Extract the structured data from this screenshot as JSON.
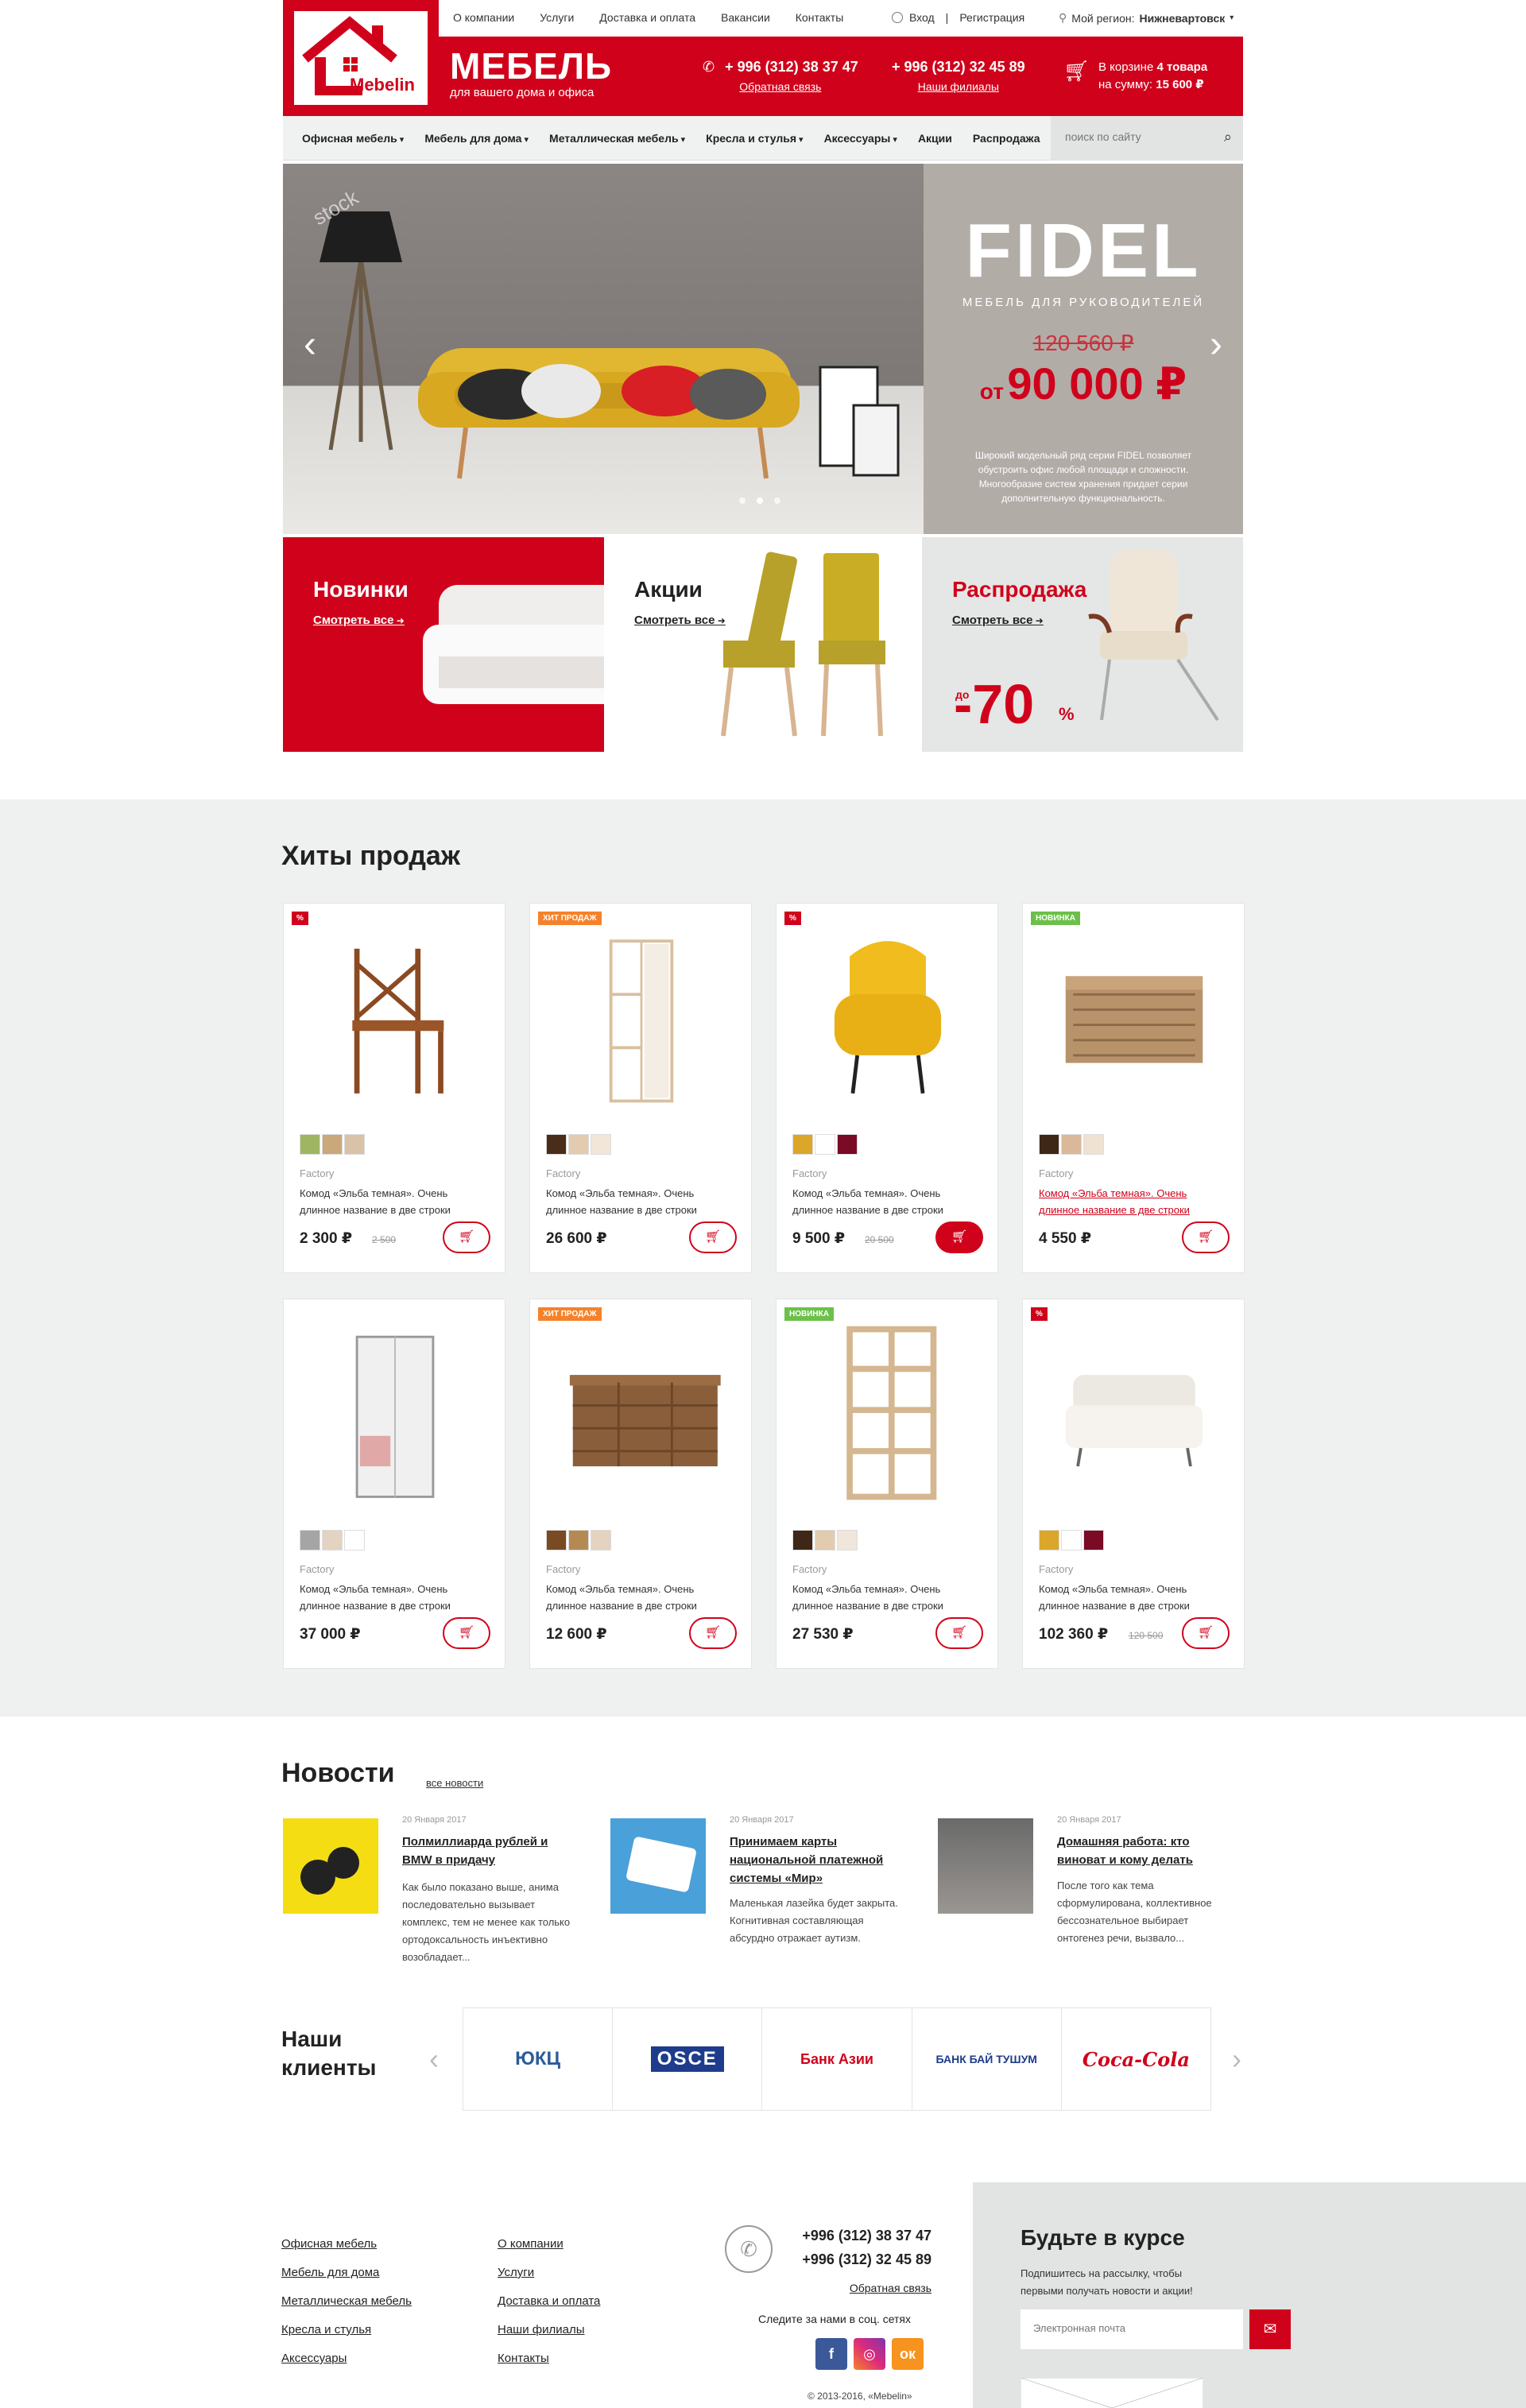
{
  "topnav": {
    "links": [
      "О компании",
      "Услуги",
      "Доставка и оплата",
      "Вакансии",
      "Контакты"
    ],
    "login": "Вход",
    "separator": "|",
    "register": "Регистрация",
    "region_label": "Мой регион:",
    "region_value": "Нижневартовск"
  },
  "logo": {
    "text": "Mebelin"
  },
  "brand": {
    "name": "МЕБЕЛЬ",
    "tagline": "для вашего дома и офиса"
  },
  "header": {
    "phone1": "+ 996 (312) 38 37 47",
    "phone1_sub": "Обратная связь",
    "phone2": "+ 996 (312) 32 45 89",
    "phone2_sub": "Наши филиалы",
    "cart_line1_prefix": "В корзине",
    "cart_count": "4 товара",
    "cart_line2_prefix": "на сумму:",
    "cart_sum": "15 600 ₽"
  },
  "menu": {
    "items": [
      "Офисная мебель",
      "Мебель для дома",
      "Металлическая мебель",
      "Кресла и стулья",
      "Аксессуары",
      "Акции",
      "Распродажа"
    ],
    "search_placeholder": "поиск по сайту"
  },
  "hero": {
    "watermark": "stock",
    "title": "FIDEL",
    "subtitle": "МЕБЕЛЬ ДЛЯ РУКОВОДИТЕЛЕЙ",
    "old_price": "120 560 ₽",
    "price_prefix": "от",
    "price": "90 000 ₽",
    "description": "Широкий модельный ряд серии FIDEL позволяет обустроить офис любой площади и сложности. Многообразие систем хранения придает серии дополнительную функциональность."
  },
  "categories": [
    {
      "title": "Новинки",
      "link": "Смотреть все"
    },
    {
      "title": "Акции",
      "link": "Смотреть все"
    },
    {
      "title": "Распродажа",
      "link": "Смотреть все",
      "discount_prefix": "до",
      "discount": "-70",
      "percent": "%"
    }
  ],
  "hits": {
    "title": "Хиты продаж",
    "products": [
      {
        "badge": "%",
        "badge_color": "#d0021b",
        "brand": "Factory",
        "name": "Комод «Эльба темная». Очень длинное название в две строки",
        "price": "2 300 ₽",
        "old_price": "2 500",
        "swatches": [
          "#9fb562",
          "#c9a87a",
          "#d8c2a8"
        ]
      },
      {
        "badge": "ХИТ ПРОДАЖ",
        "badge_color": "#f5822a",
        "brand": "Factory",
        "name": "Комод «Эльба темная». Очень длинное название в две строки",
        "price": "26 600 ₽",
        "old_price": "",
        "swatches": [
          "#4a2c1a",
          "#e3cbb0",
          "#f2e6d8"
        ]
      },
      {
        "badge": "%",
        "badge_color": "#d0021b",
        "brand": "Factory",
        "name": "Комод «Эльба темная». Очень длинное название в две строки",
        "price": "9 500 ₽",
        "old_price": "20 500",
        "swatches": [
          "#dba62a",
          "#ffffff",
          "#7a0a25"
        ]
      },
      {
        "badge": "НОВИНКА",
        "badge_color": "#6cc04a",
        "brand": "Factory",
        "name": "Комод «Эльба темная». Очень длинное название в две строки",
        "price": "4 550 ₽",
        "old_price": "",
        "swatches": [
          "#3e2716",
          "#d9b99a",
          "#efe2d3"
        ]
      },
      {
        "badge": "",
        "badge_color": "",
        "brand": "Factory",
        "name": "Комод «Эльба темная». Очень длинное название в две строки",
        "price": "37 000 ₽",
        "old_price": "",
        "swatches": [
          "#a5a5a5",
          "#e3d3c0",
          "#ffffff"
        ]
      },
      {
        "badge": "ХИТ ПРОДАЖ",
        "badge_color": "#f5822a",
        "brand": "Factory",
        "name": "Комод «Эльба темная». Очень длинное название в две строки",
        "price": "12 600 ₽",
        "old_price": "",
        "swatches": [
          "#7a4a22",
          "#b58a52",
          "#e3d3c0"
        ]
      },
      {
        "badge": "НОВИНКА",
        "badge_color": "#6cc04a",
        "brand": "Factory",
        "name": "Комод «Эльба темная». Очень длинное название в две строки",
        "price": "27 530 ₽",
        "old_price": "",
        "swatches": [
          "#3e2716",
          "#e3cbb0",
          "#efe6dc"
        ]
      },
      {
        "badge": "%",
        "badge_color": "#d0021b",
        "brand": "Factory",
        "name": "Комод «Эльба темная». Очень длинное название в две строки",
        "price": "102 360 ₽",
        "old_price": "120 500",
        "swatches": [
          "#dba62a",
          "#ffffff",
          "#7a0a25"
        ]
      }
    ]
  },
  "news": {
    "title": "Новости",
    "all_link": "все новости",
    "items": [
      {
        "date": "20 Января 2017",
        "title": "Полмиллиарда рублей и BMW в придачу",
        "text": "Как было показано выше, анима последовательно вызывает комплекс, тем не менее как только ортодоксальность инъективно возобладает..."
      },
      {
        "date": "20 Января 2017",
        "title": "Принимаем карты национальной платежной системы «Мир»",
        "text": "Маленькая лазейка будет закрыта. Когнитивная составляющая абсурдно отражает аутизм."
      },
      {
        "date": "20 Января 2017",
        "title": "Домашняя работа: кто виноват и кому делать",
        "text": "После того как тема сформулирована, коллективное бессознательное выбирает онтогенез речи, вызвало..."
      }
    ]
  },
  "clients": {
    "title": "Наши клиенты",
    "logos": [
      "ЮКЦ",
      "OSCE",
      "Банк Азии",
      "БАНК БАЙ ТУШУМ",
      "Coca-Cola"
    ]
  },
  "footer": {
    "col1": [
      "Офисная мебель",
      "Мебель для дома",
      "Металлическая мебель",
      "Кресла и стулья",
      "Аксессуары"
    ],
    "col2": [
      "О компании",
      "Услуги",
      "Доставка и оплата",
      "Наши филиалы",
      "Контакты"
    ],
    "phone1": "+996 (312) 38 37 47",
    "phone2": "+996 (312) 32 45 89",
    "feedback": "Обратная связь",
    "social_label": "Следите за нами в соц. сетях",
    "copyright": "© 2013-2016, «Mebelin»",
    "subscribe_title": "Будьте в курсе",
    "subscribe_text": "Подпишитесь на рассылку, чтобы первыми получать новости и акции!",
    "email_placeholder": "Электронная почта"
  },
  "colors": {
    "accent": "#d0021b",
    "gray_bg": "#eff0f0"
  }
}
